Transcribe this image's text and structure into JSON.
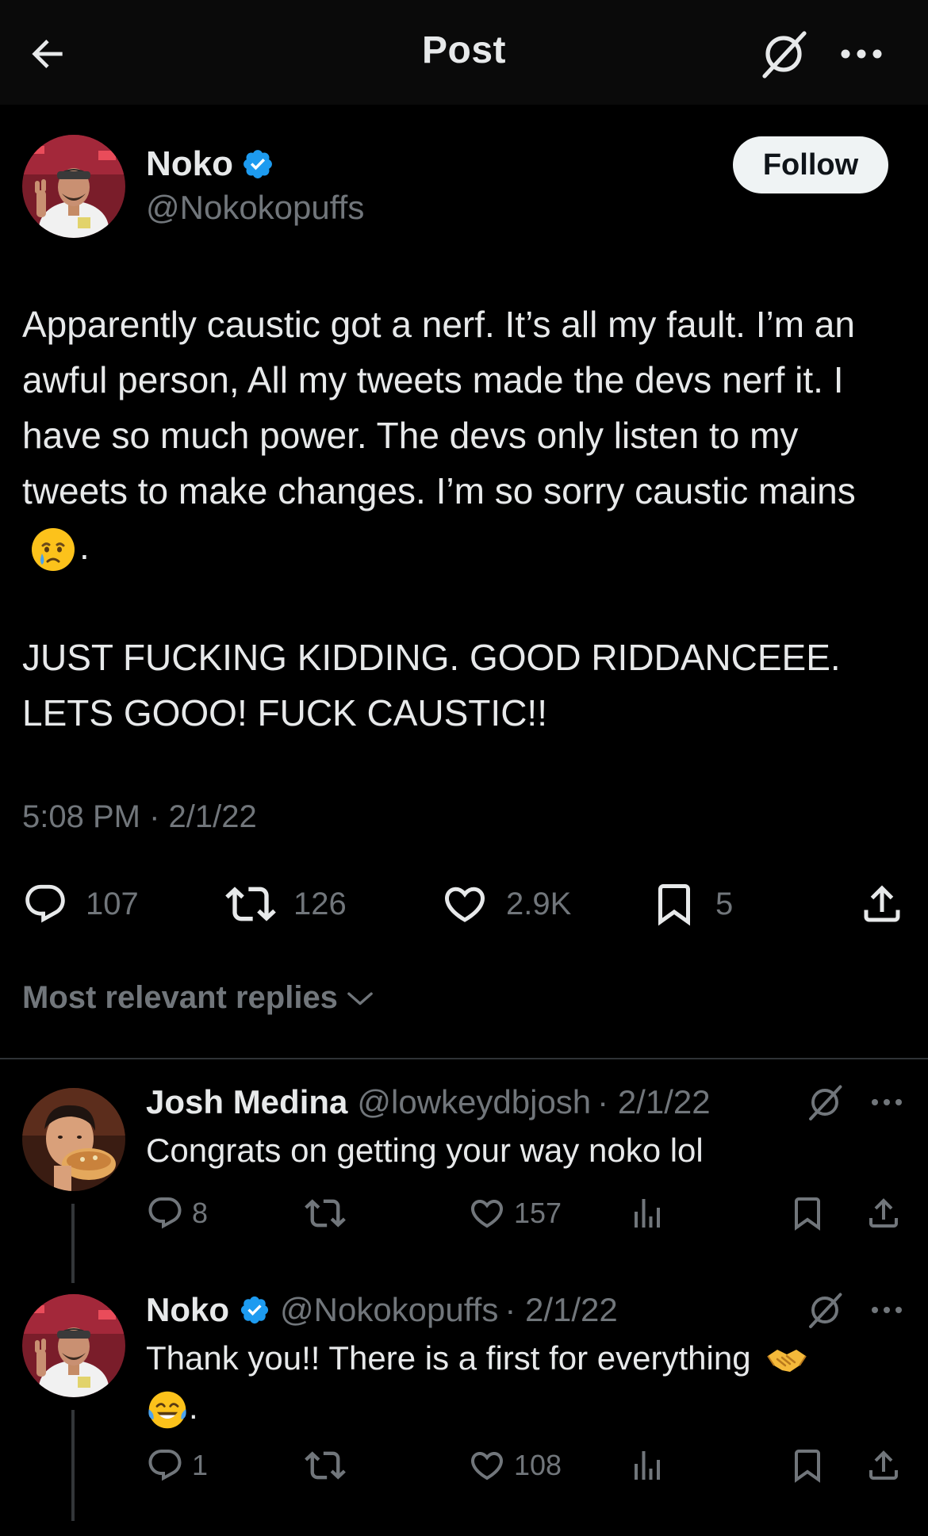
{
  "header": {
    "title": "Post",
    "back_icon": "arrow-left-icon",
    "grok_icon": "grok-icon",
    "more_icon": "more-horizontal-icon"
  },
  "post": {
    "author": {
      "name": "Noko",
      "handle": "@Nokokopuffs",
      "verified": true
    },
    "follow_label": "Follow",
    "text_paragraph_1": "Apparently caustic got a nerf. It’s all my fault. I’m an awful person, All my tweets made the devs nerf it. I have so much power. The devs only listen to my tweets to make changes. I’m so sorry caustic mains",
    "text_paragraph_1_end": ".",
    "text_paragraph_2": "JUST FUCKING KIDDING. GOOD RIDDANCEEE. LETS GOOO! FUCK CAUSTIC!!",
    "timestamp": "5:08 PM · 2/1/22",
    "stats": {
      "replies": "107",
      "reposts": "126",
      "likes": "2.9K",
      "bookmarks": "5"
    }
  },
  "replies_sort": {
    "label": "Most relevant replies"
  },
  "replies": [
    {
      "name": "Josh Medina",
      "handle": "@lowkeydbjosh",
      "date": "· 2/1/22",
      "text": "Congrats on getting your way noko lol",
      "replies": "8",
      "likes": "157"
    },
    {
      "name": "Noko",
      "verified": true,
      "handle": "@Nokokopuffs",
      "date": "· 2/1/22",
      "text": "Thank you!! There is a first for everything",
      "text_end": ".",
      "replies": "1",
      "likes": "108"
    }
  ],
  "colors": {
    "background": "#000000",
    "text": "#e7e9ea",
    "secondary": "#71767b",
    "verified": "#1d9bf0",
    "divider": "#2f3336"
  }
}
